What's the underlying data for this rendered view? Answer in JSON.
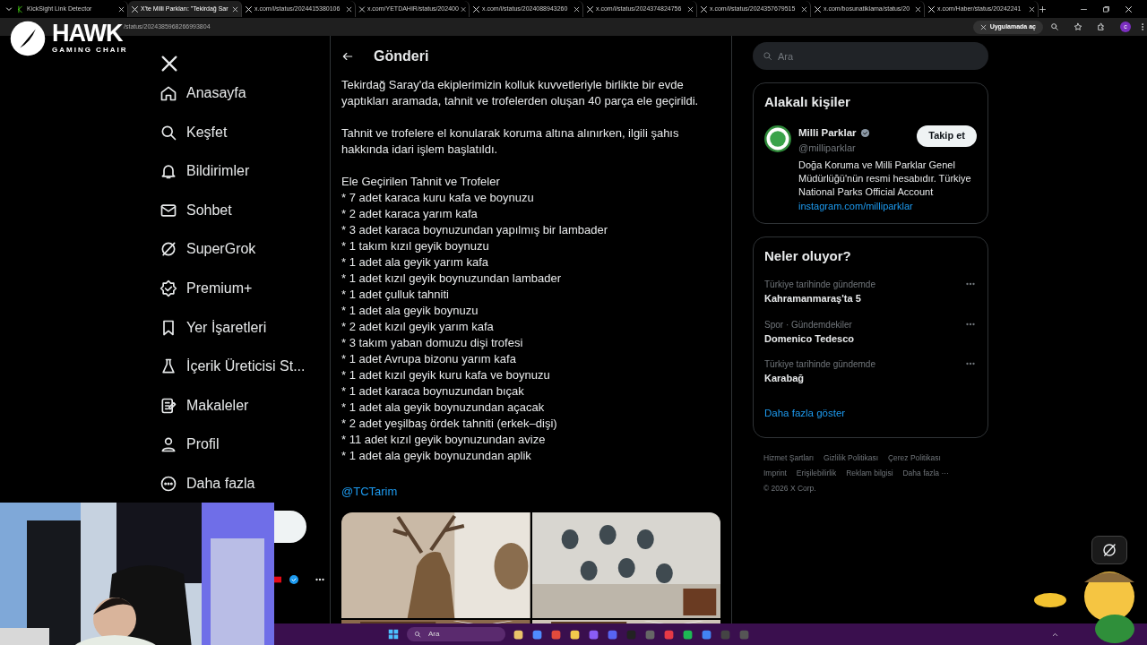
{
  "browser": {
    "tabs": [
      {
        "title": "KickSight Link Detector",
        "selected": false
      },
      {
        "title": "X'te Milli Parkları: \"Tekirdağ Sar",
        "selected": true
      },
      {
        "title": "x.com/i/status/2024415380106",
        "selected": false
      },
      {
        "title": "x.com/YETDAHIR/status/202400",
        "selected": false
      },
      {
        "title": "x.com/i/status/2024088943260",
        "selected": false
      },
      {
        "title": "x.com/i/status/2024374824756",
        "selected": false
      },
      {
        "title": "x.com/i/status/2024357679515",
        "selected": false
      },
      {
        "title": "x.com/bosunatiklama/status/20",
        "selected": false
      },
      {
        "title": "x.com/Haber/status/20242241",
        "selected": false
      }
    ],
    "address": "/status/2024385968266993804",
    "open_in_app": "Uygulamada aç",
    "profile_initial": "c"
  },
  "overlay": {
    "brand": "HAWK",
    "tagline": "GAMING CHAIR"
  },
  "nav": {
    "items": [
      {
        "label": "Anasayfa"
      },
      {
        "label": "Keşfet"
      },
      {
        "label": "Bildirimler"
      },
      {
        "label": "Sohbet"
      },
      {
        "label": "SuperGrok"
      },
      {
        "label": "Premium+"
      },
      {
        "label": "Yer İşaretleri"
      },
      {
        "label": "İçerik Üreticisi St..."
      },
      {
        "label": "Makaleler"
      },
      {
        "label": "Profil"
      },
      {
        "label": "Daha fazla"
      }
    ]
  },
  "post": {
    "header": "Gönderi",
    "paragraphs": [
      "Tekirdağ Saray'da ekiplerimizin kolluk kuvvetleriyle birlikte bir evde yaptıkları aramada, tahnit ve trofelerden oluşan 40 parça ele geçirildi.",
      "Tahnit ve trofelere el konularak koruma altına alınırken, ilgili şahıs hakkında idari işlem başlatıldı."
    ],
    "list_title": "Ele Geçirilen Tahnit ve Trofeler",
    "list": [
      "* 7 adet karaca kuru kafa ve boynuzu",
      "* 2 adet karaca yarım kafa",
      "* 3 adet karaca boynuzundan yapılmış bir lambader",
      "* 1 takım kızıl geyik boynuzu",
      "* 1 adet ala geyik yarım kafa",
      "* 1 adet kızıl geyik boynuzundan lambader",
      "* 1 adet çulluk tahniti",
      "* 1 adet ala geyik boynuzu",
      "* 2 adet kızıl geyik yarım kafa",
      "* 3 takım yaban domuzu dişi trofesi",
      "* 1 adet Avrupa bizonu yarım kafa",
      "* 1 adet kızıl geyik kuru kafa ve boynuzu",
      "* 1 adet karaca boynuzundan bıçak",
      "* 1 adet ala geyik boynuzundan açacak",
      "* 2 adet yeşilbaş ördek tahniti (erkek–dişi)",
      "* 11 adet kızıl geyik boynuzundan avize",
      "* 1 adet ala geyik boynuzundan aplik"
    ],
    "mention": "@TCTarim"
  },
  "right": {
    "search_placeholder": "Ara",
    "related": {
      "title": "Alakalı kişiler",
      "name": "Milli Parklar",
      "verified": true,
      "handle": "@milliparklar",
      "follow": "Takip et",
      "bio": "Doğa Koruma ve Milli Parklar Genel Müdürlüğü'nün resmi hesabıdır. Türkiye National Parks Official Account",
      "link": "instagram.com/milliparklar"
    },
    "trends": {
      "title": "Neler oluyor?",
      "items": [
        {
          "context": "Türkiye tarihinde gündemde",
          "topic": "Kahramanmaraş'ta 5"
        },
        {
          "context": "Spor · Gündemdekiler",
          "topic": "Domenico Tedesco"
        },
        {
          "context": "Türkiye tarihinde gündemde",
          "topic": "Karabağ"
        }
      ],
      "more": "Daha fazla göster"
    },
    "footer": {
      "links": [
        "Hizmet Şartları",
        "Gizlilik Politikası",
        "Çerez Politikası",
        "Imprint",
        "Erişilebilirlik",
        "Reklam bilgisi",
        "Daha fazla ···"
      ],
      "copyright": "© 2026 X Corp."
    }
  },
  "taskbar": {
    "search": "Ara"
  }
}
